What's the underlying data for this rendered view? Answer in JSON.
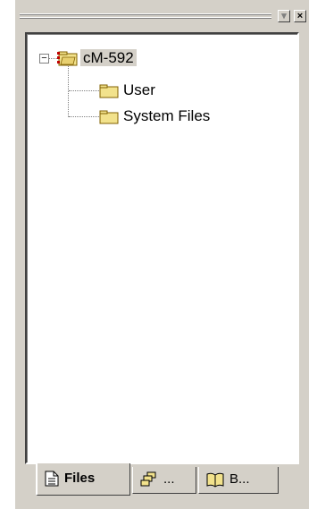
{
  "window": {
    "collapse_glyph": "▾",
    "close_glyph": "×"
  },
  "tree": {
    "root": {
      "label": "cM-592",
      "expander": "−",
      "icon": "workspace-folder-icon"
    },
    "children": [
      {
        "label": "User",
        "icon": "folder-icon"
      },
      {
        "label": "System Files",
        "icon": "folder-icon"
      }
    ]
  },
  "tabs": [
    {
      "label": "Files",
      "icon": "document-icon",
      "active": true
    },
    {
      "label": "...",
      "icon": "classes-icon",
      "active": false
    },
    {
      "label": "B...",
      "icon": "book-icon",
      "active": false
    }
  ],
  "colors": {
    "panel": "#d4d0c8",
    "folder": "#f2e28c",
    "selection": "#d4d0c8"
  }
}
